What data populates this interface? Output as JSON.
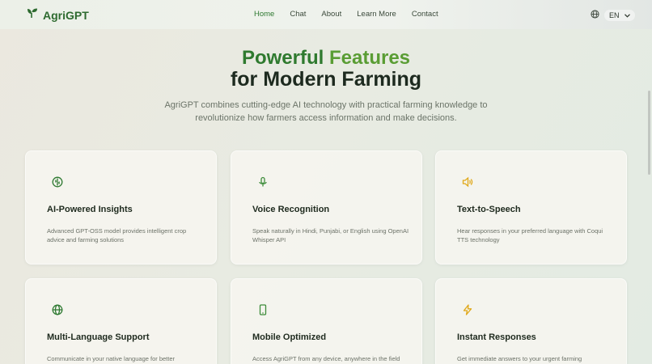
{
  "header": {
    "brand": "AgriGPT",
    "nav": [
      {
        "label": "Home",
        "active": true
      },
      {
        "label": "Chat",
        "active": false
      },
      {
        "label": "About",
        "active": false
      },
      {
        "label": "Learn More",
        "active": false
      },
      {
        "label": "Contact",
        "active": false
      }
    ],
    "language": "EN"
  },
  "hero": {
    "title_word1": "Powerful",
    "title_word2": "Features",
    "title_line2": "for Modern Farming",
    "subtitle": "AgriGPT combines cutting-edge AI technology with practical farming knowledge to revolutionize how farmers access information and make decisions."
  },
  "features": [
    {
      "icon": "brain-icon",
      "icon_color": "#2f7a32",
      "title": "AI-Powered Insights",
      "desc": "Advanced GPT-OSS model provides intelligent crop advice and farming solutions"
    },
    {
      "icon": "microphone-icon",
      "icon_color": "#3d8c3a",
      "title": "Voice Recognition",
      "desc": "Speak naturally in Hindi, Punjabi, or English using OpenAI Whisper API"
    },
    {
      "icon": "speaker-icon",
      "icon_color": "#e0a818",
      "title": "Text-to-Speech",
      "desc": "Hear responses in your preferred language with Coqui TTS technology"
    },
    {
      "icon": "globe-icon",
      "icon_color": "#2f7a32",
      "title": "Multi-Language Support",
      "desc": "Communicate in your native language for better"
    },
    {
      "icon": "mobile-icon",
      "icon_color": "#3d8c3a",
      "title": "Mobile Optimized",
      "desc": "Access AgriGPT from any device, anywhere in the field"
    },
    {
      "icon": "lightning-icon",
      "icon_color": "#e0a818",
      "title": "Instant Responses",
      "desc": "Get immediate answers to your urgent farming"
    }
  ]
}
